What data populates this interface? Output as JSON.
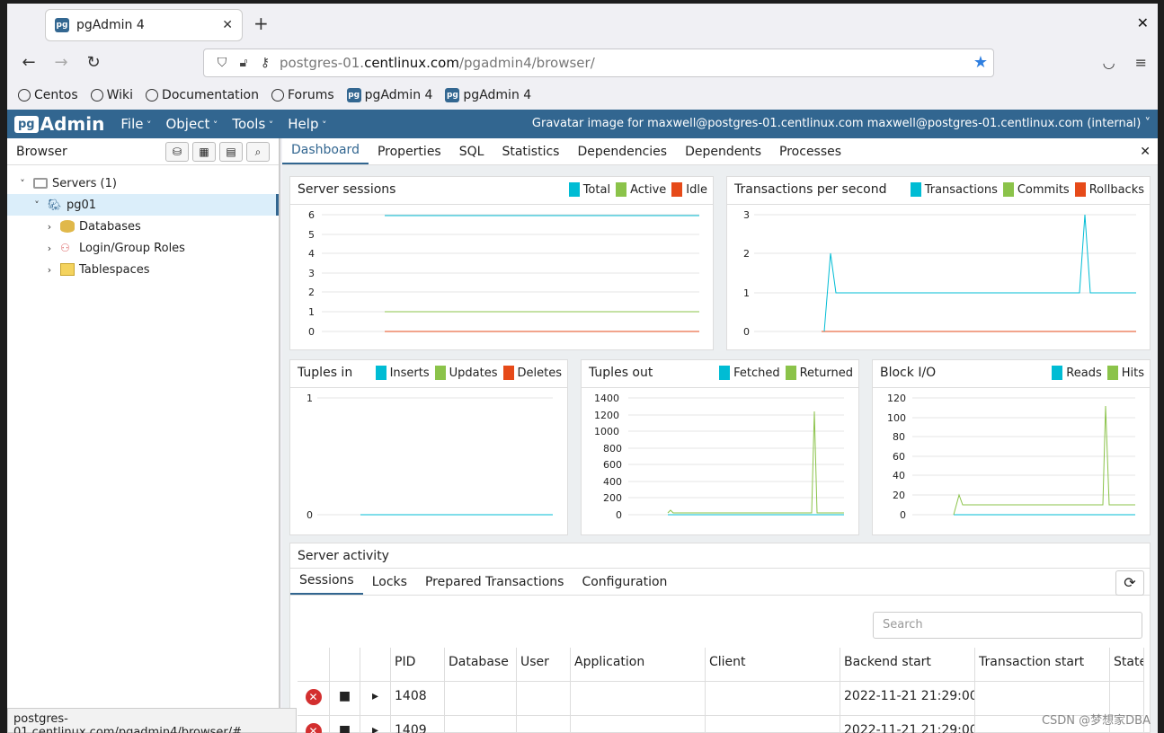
{
  "browser": {
    "tab_title": "pgAdmin 4",
    "url_prefix": "postgres-01.",
    "url_host": "centlinux.com",
    "url_path": "/pgadmin4/browser/",
    "bookmarks": [
      "Centos",
      "Wiki",
      "Documentation",
      "Forums",
      "pgAdmin 4",
      "pgAdmin 4"
    ],
    "status_url": "postgres-01.centlinux.com/pgadmin4/browser/#"
  },
  "pgadmin": {
    "logo_pg": "pg",
    "logo_text": "Admin",
    "menus": [
      "File",
      "Object",
      "Tools",
      "Help"
    ],
    "user": "Gravatar image for maxwell@postgres-01.centlinux.com maxwell@postgres-01.centlinux.com (internal) ˅"
  },
  "tree": {
    "header": "Browser",
    "servers": "Servers (1)",
    "server": "pg01",
    "children": [
      "Databases",
      "Login/Group Roles",
      "Tablespaces"
    ]
  },
  "main_tabs": [
    "Dashboard",
    "Properties",
    "SQL",
    "Statistics",
    "Dependencies",
    "Dependents",
    "Processes"
  ],
  "colors": {
    "total": "#00bcd4",
    "active": "#8bc34a",
    "idle": "#e64a19"
  },
  "charts": {
    "sessions": {
      "title": "Server sessions",
      "legend": [
        "Total",
        "Active",
        "Idle"
      ],
      "yticks": [
        "6",
        "5",
        "4",
        "3",
        "2",
        "1",
        "0"
      ]
    },
    "tps": {
      "title": "Transactions per second",
      "legend": [
        "Transactions",
        "Commits",
        "Rollbacks"
      ],
      "yticks": [
        "3",
        "2",
        "1",
        "0"
      ]
    },
    "tuples_in": {
      "title": "Tuples in",
      "legend": [
        "Inserts",
        "Updates",
        "Deletes"
      ],
      "yticks": [
        "1",
        "0"
      ]
    },
    "tuples_out": {
      "title": "Tuples out",
      "legend": [
        "Fetched",
        "Returned"
      ],
      "yticks": [
        "1400",
        "1200",
        "1000",
        "800",
        "600",
        "400",
        "200",
        "0"
      ]
    },
    "blockio": {
      "title": "Block I/O",
      "legend": [
        "Reads",
        "Hits"
      ],
      "yticks": [
        "120",
        "100",
        "80",
        "60",
        "40",
        "20",
        "0"
      ]
    }
  },
  "activity": {
    "title": "Server activity",
    "tabs": [
      "Sessions",
      "Locks",
      "Prepared Transactions",
      "Configuration"
    ],
    "search_placeholder": "Search",
    "columns": [
      "PID",
      "Database",
      "User",
      "Application",
      "Client",
      "Backend start",
      "Transaction start",
      "State"
    ],
    "rows": [
      {
        "pid": "1408",
        "backend_start": "2022-11-21 21:29:00..."
      },
      {
        "pid": "1409",
        "backend_start": "2022-11-21 21:29:00..."
      }
    ]
  },
  "watermark": "CSDN @梦想家DBA"
}
